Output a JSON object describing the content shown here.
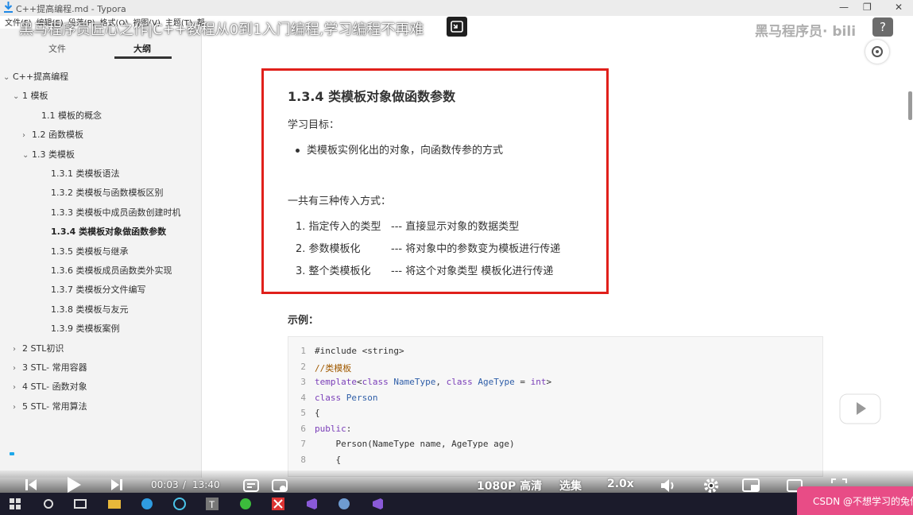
{
  "window": {
    "title": "C++提高编程.md - Typora"
  },
  "menu": [
    "文件(F)",
    "编辑(E)",
    "段落(P)",
    "格式(O)",
    "视图(V)",
    "主题(T)",
    "帮助(H)"
  ],
  "sidebar": {
    "tabs": [
      "文件",
      "大纲"
    ],
    "outline": [
      {
        "label": "C++提高编程",
        "caret": "v"
      },
      {
        "label": "1 模板",
        "caret": "v"
      },
      {
        "label": "1.1 模板的概念",
        "caret": ""
      },
      {
        "label": "1.2 函数模板",
        "caret": ">"
      },
      {
        "label": "1.3 类模板",
        "caret": "v"
      },
      {
        "label": "1.3.1 类模板语法",
        "caret": ""
      },
      {
        "label": "1.3.2 类模板与函数模板区别",
        "caret": ""
      },
      {
        "label": "1.3.3 类模板中成员函数创建时机",
        "caret": ""
      },
      {
        "label": "1.3.4 类模板对象做函数参数",
        "caret": "",
        "active": true
      },
      {
        "label": "1.3.5 类模板与继承",
        "caret": ""
      },
      {
        "label": "1.3.6 类模板成员函数类外实现",
        "caret": ""
      },
      {
        "label": "1.3.7 类模板分文件编写",
        "caret": ""
      },
      {
        "label": "1.3.8 类模板与友元",
        "caret": ""
      },
      {
        "label": "1.3.9 类模板案例",
        "caret": ""
      },
      {
        "label": "2 STL初识",
        "caret": ">"
      },
      {
        "label": "3 STL- 常用容器",
        "caret": ">"
      },
      {
        "label": "4 STL- 函数对象",
        "caret": ">"
      },
      {
        "label": "5 STL- 常用算法",
        "caret": ">"
      }
    ]
  },
  "doc": {
    "heading": "1.3.4 类模板对象做函数参数",
    "goal_label": "学习目标：",
    "goal_item": "类模板实例化出的对象，向函数传参的方式",
    "ways_label": "一共有三种传入方式：",
    "ways": [
      {
        "a": "1. 指定传入的类型",
        "b": "--- 直接显示对象的数据类型"
      },
      {
        "a": "2. 参数模板化",
        "b": "--- 将对象中的参数变为模板进行传递"
      },
      {
        "a": "3. 整个类模板化",
        "b": "--- 将这个对象类型 模板化进行传递"
      }
    ],
    "example_label": "示例：",
    "code": [
      {
        "n": "1",
        "parts": [
          [
            "",
            "#include <string>"
          ]
        ]
      },
      {
        "n": "2",
        "parts": [
          [
            "cm",
            "//类模板"
          ]
        ]
      },
      {
        "n": "3",
        "parts": [
          [
            "kw",
            "template"
          ],
          [
            "",
            "<"
          ],
          [
            "kw",
            "class"
          ],
          [
            "ty",
            " NameType"
          ],
          [
            "",
            ", "
          ],
          [
            "kw",
            "class"
          ],
          [
            "ty",
            " AgeType"
          ],
          [
            "",
            " = "
          ],
          [
            "kw",
            "int"
          ],
          [
            "",
            ">"
          ]
        ]
      },
      {
        "n": "4",
        "parts": [
          [
            "kw",
            "class"
          ],
          [
            "ty",
            " Person"
          ]
        ]
      },
      {
        "n": "5",
        "parts": [
          [
            "",
            "{"
          ]
        ]
      },
      {
        "n": "6",
        "parts": [
          [
            "kw",
            "public"
          ],
          [
            "",
            ":"
          ]
        ]
      },
      {
        "n": "7",
        "parts": [
          [
            "",
            "    Person(NameType name, AgeType age)"
          ]
        ]
      },
      {
        "n": "8",
        "parts": [
          [
            "",
            "    {"
          ]
        ]
      }
    ]
  },
  "video": {
    "title": "黑马程序员匠心之作|C++教程从0到1入门编程,学习编程不再难",
    "watermark": "黑马程序员·",
    "time_current": "00:03",
    "time_sep": "/",
    "time_total": "13:40",
    "quality": "1080P 高清",
    "episodes": "选集",
    "speed": "2.0x",
    "help": "?",
    "progress_fraction": 0.004
  },
  "taskbar": {
    "notification": "CSDN @不想学习的兔仔"
  },
  "colors": {
    "highlight": "#e0201b",
    "progress": "#1ea8ea",
    "taskbar": "#1b1b2b"
  }
}
